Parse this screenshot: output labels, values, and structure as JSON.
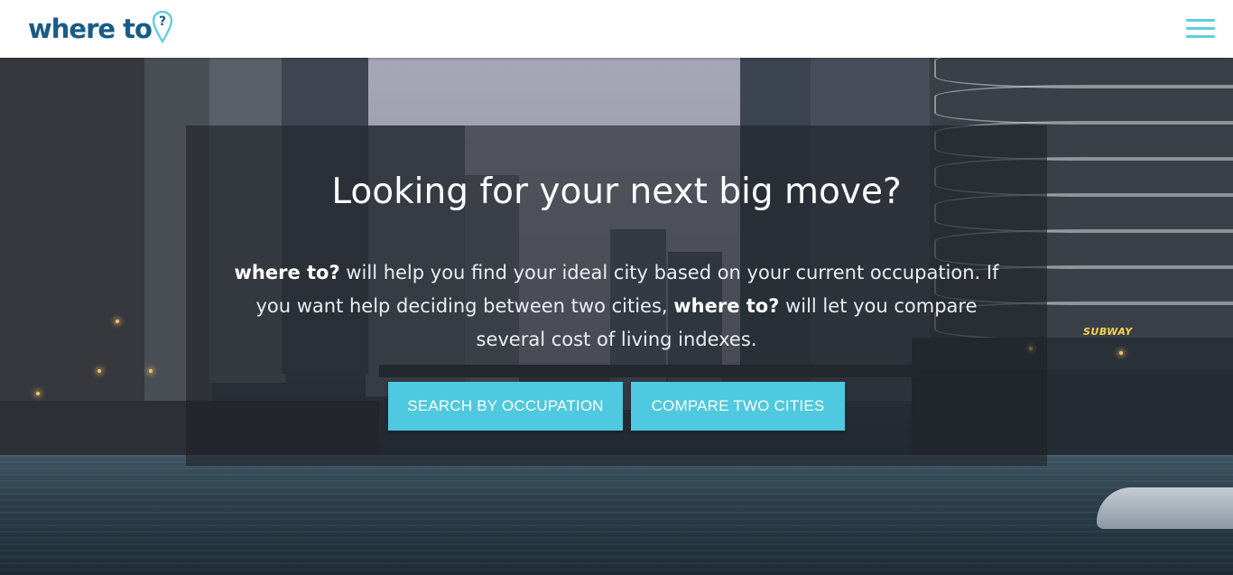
{
  "header": {
    "logo_text": "where to",
    "logo_mark": "?",
    "menu_icon": "hamburger-menu-icon"
  },
  "hero": {
    "title": "Looking for your next big move?",
    "description": {
      "brand_1": "where to?",
      "part_1": " will help you find your ideal city based on your current occupation. If you want help deciding between two cities, ",
      "brand_2": "where to?",
      "part_2": " will let you compare several cost of living indexes."
    },
    "buttons": {
      "search_by_occupation": "SEARCH BY OCCUPATION",
      "compare_two_cities": "COMPARE TWO CITIES"
    },
    "background_sign": "SUBWAY"
  },
  "colors": {
    "brand_blue": "#1a5a86",
    "accent_cyan": "#4ec9df"
  }
}
